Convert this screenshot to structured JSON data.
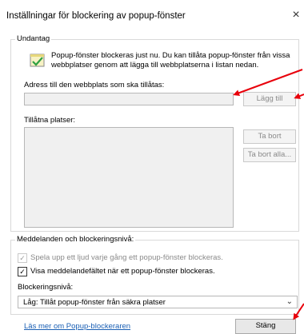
{
  "window": {
    "title": "Inställningar för blockering av popup-fönster",
    "close_glyph": "×"
  },
  "exceptions": {
    "legend": "Undantag",
    "info_text": "Popup-fönster blockeras just nu. Du kan tillåta popup-fönster från vissa webbplatser genom att lägga till webbplatserna i listan nedan.",
    "address_label": "Adress till den webbplats som ska tillåtas:",
    "address_value": "",
    "add_button": "Lägg till",
    "allowed_label": "Tillåtna platser:",
    "remove_button": "Ta bort",
    "remove_all_button": "Ta bort alla..."
  },
  "notifications": {
    "legend": "Meddelanden och blockeringsnivå:",
    "sound_label": "Spela upp ett ljud varje gång ett popup-fönster blockeras.",
    "sound_checked": true,
    "bar_label": "Visa meddelandefältet när ett popup-fönster blockeras.",
    "bar_checked": true,
    "level_label": "Blockeringsnivå:",
    "level_value": "Låg: Tillåt popup-fönster från säkra platser"
  },
  "footer": {
    "learn_more": "Läs mer om Popup-blockeraren",
    "close_button": "Stäng"
  },
  "colors": {
    "arrow": "#e8000b",
    "link": "#1a5fb4"
  }
}
